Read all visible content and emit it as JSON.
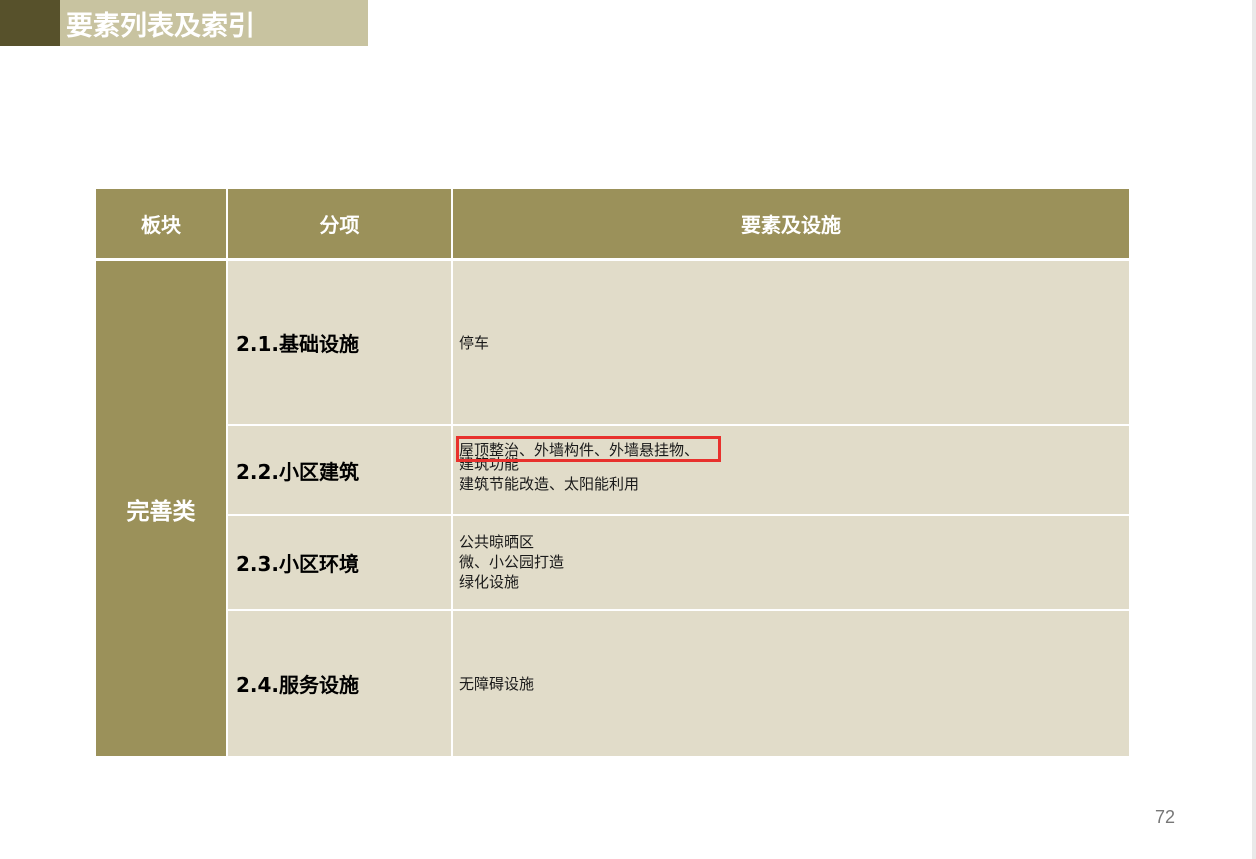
{
  "page": {
    "title": "要素列表及索引",
    "page_number": "72"
  },
  "table": {
    "headers": [
      "板块",
      "分项",
      "要素及设施"
    ],
    "sector": "完善类",
    "rows": [
      {
        "subitem": "2.1.基础设施",
        "elements": [
          "停车"
        ]
      },
      {
        "subitem": "2.2.小区建筑",
        "elements": [
          "屋顶整治、外墙构件、外墙悬挂物、",
          "建筑功能",
          "建筑节能改造、太阳能利用"
        ]
      },
      {
        "subitem": "2.3.小区环境",
        "elements": [
          "公共晾晒区",
          "微、小公园打造",
          "绿化设施"
        ]
      },
      {
        "subitem": "2.4.服务设施",
        "elements": [
          "无障碍设施"
        ]
      }
    ]
  },
  "colors": {
    "header_bg": "#9b915a",
    "cell_bg": "#e1dcc9",
    "title_bar": "#c8c3a0",
    "title_accent": "#57512b",
    "highlight": "#e8312d"
  }
}
